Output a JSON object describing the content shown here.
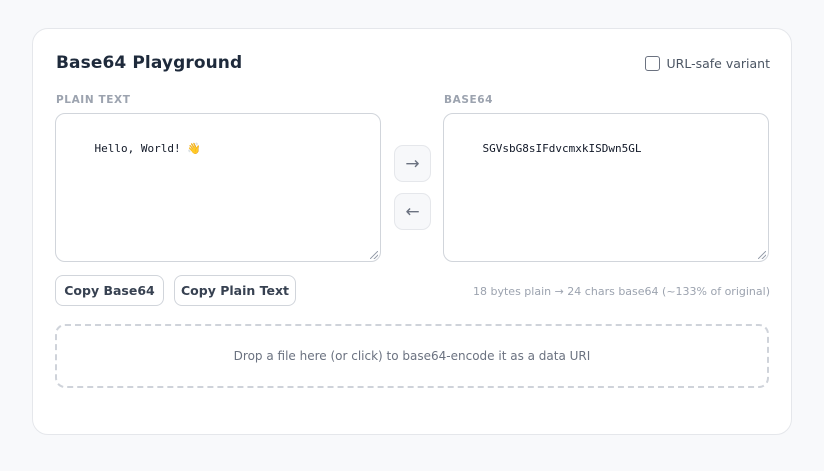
{
  "header": {
    "title": "Base64 Playground",
    "url_safe_label": "URL-safe variant",
    "url_safe_checked": false
  },
  "plain": {
    "label": "PLAIN TEXT",
    "value": "Hello, World! 👋"
  },
  "base64": {
    "label": "BASE64",
    "value": "SGVsbG8sIFdvcmxkISDwn5GL"
  },
  "arrows": {
    "encode": "→",
    "decode": "←"
  },
  "actions": {
    "copy_base64": "Copy Base64",
    "copy_plain": "Copy Plain Text"
  },
  "stats": "18 bytes plain → 24 chars base64 (~133% of original)",
  "dropzone": "Drop a file here (or click) to base64-encode it as a data URI"
}
